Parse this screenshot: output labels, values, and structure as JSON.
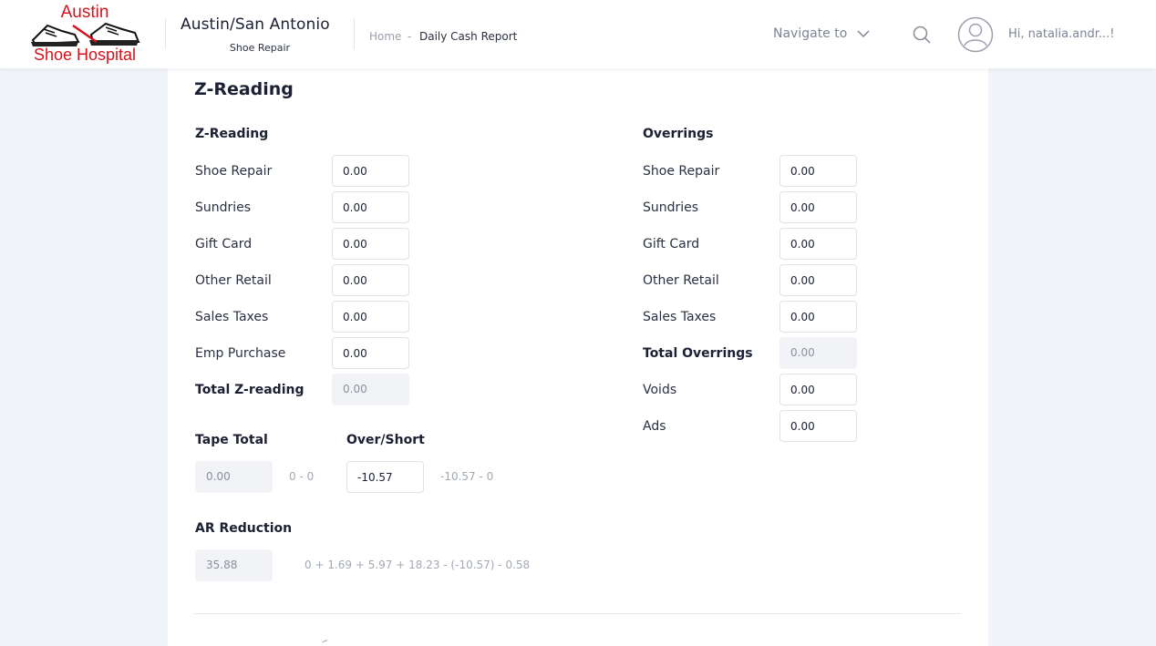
{
  "header": {
    "logo": {
      "line1": "Austin",
      "line2": "Shoe Hospital"
    },
    "brand_title": "Austin/San Antonio",
    "brand_subtitle": "Shoe Repair",
    "breadcrumb": {
      "home": "Home",
      "separator": "-",
      "current": "Daily Cash Report"
    },
    "navigate_label": "Navigate to",
    "greeting": "Hi, natalia.andr...!"
  },
  "card": {
    "title": "Z-Reading",
    "zreading": {
      "heading": "Z-Reading",
      "rows": [
        {
          "label": "Shoe Repair",
          "value": "0.00"
        },
        {
          "label": "Sundries",
          "value": "0.00"
        },
        {
          "label": "Gift Card",
          "value": "0.00"
        },
        {
          "label": "Other Retail",
          "value": "0.00"
        },
        {
          "label": "Sales Taxes",
          "value": "0.00"
        },
        {
          "label": "Emp Purchase",
          "value": "0.00"
        }
      ],
      "total_label": "Total Z-reading",
      "total_value": "0.00"
    },
    "overrings": {
      "heading": "Overrings",
      "rows": [
        {
          "label": "Shoe Repair",
          "value": "0.00"
        },
        {
          "label": "Sundries",
          "value": "0.00"
        },
        {
          "label": "Gift Card",
          "value": "0.00"
        },
        {
          "label": "Other Retail",
          "value": "0.00"
        },
        {
          "label": "Sales Taxes",
          "value": "0.00"
        }
      ],
      "total_label": "Total Overrings",
      "total_value": "0.00",
      "voids_label": "Voids",
      "voids_value": "0.00",
      "ads_label": "Ads",
      "ads_value": "0.00"
    },
    "tape_total": {
      "label": "Tape Total",
      "value": "0.00",
      "formula": "0 - 0"
    },
    "over_short": {
      "label": "Over/Short",
      "value": "-10.57",
      "formula": "-10.57 - 0"
    },
    "ar_reduction": {
      "label": "AR Reduction",
      "value": "35.88",
      "formula": "0 + 1.69 + 5.97 + 18.23 - (-10.57) - 0.58"
    }
  },
  "colors": {
    "logo_red": "#d5121b",
    "background": "#f1f4f9"
  },
  "icons": [
    "chevron-down-icon",
    "search-icon",
    "user-avatar-icon"
  ]
}
